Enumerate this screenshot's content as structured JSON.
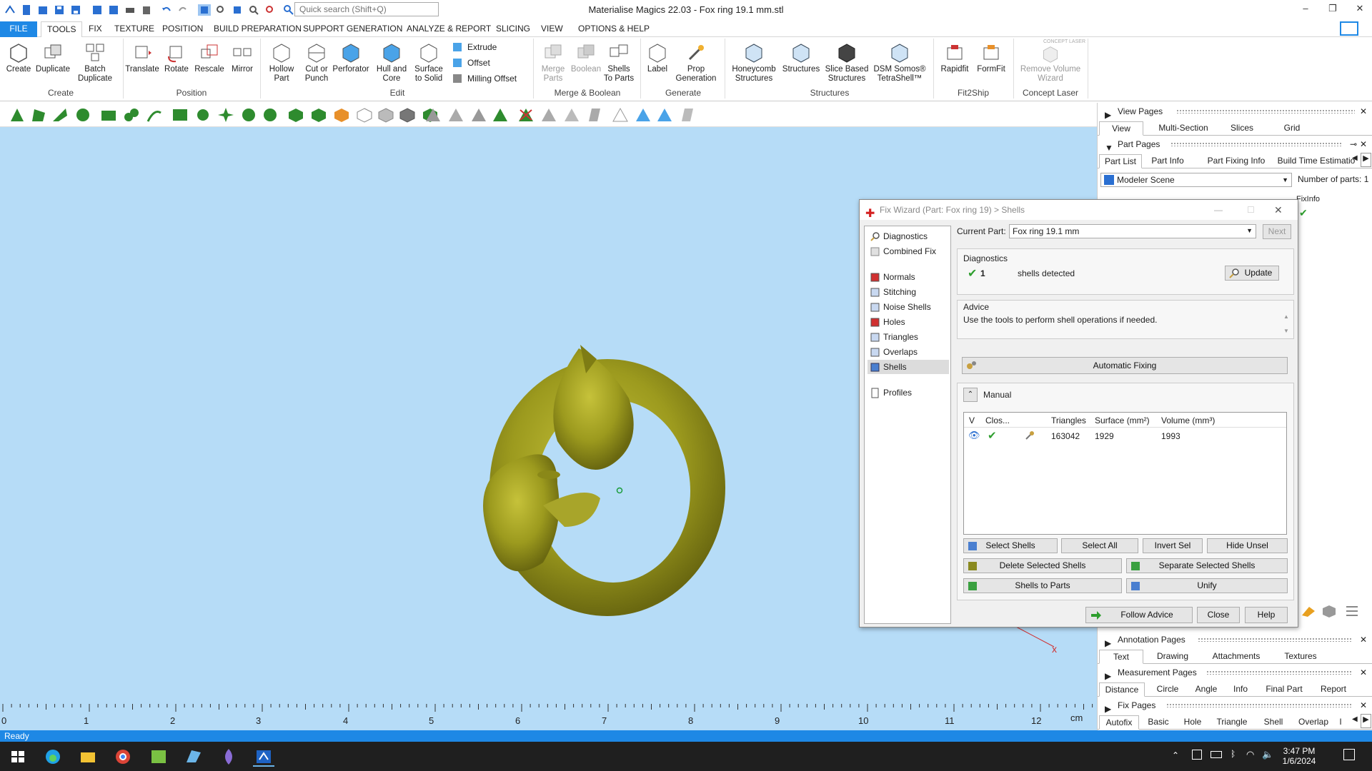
{
  "titlebar": {
    "search_placeholder": "Quick search (Shift+Q)",
    "title": "Materialise Magics 22.03 - Fox ring 19.1 mm.stl"
  },
  "menu": {
    "file": "FILE",
    "tools": "TOOLS",
    "fix": "FIX",
    "texture": "TEXTURE",
    "position": "POSITION",
    "build_preparation": "BUILD PREPARATION",
    "support_generation": "SUPPORT GENERATION",
    "analyze_report": "ANALYZE & REPORT",
    "slicing": "SLICING",
    "view": "VIEW",
    "options_help": "OPTIONS & HELP"
  },
  "ribbon": {
    "create": "Create",
    "duplicate": "Duplicate",
    "batch_duplicate_1": "Batch",
    "batch_duplicate_2": "Duplicate",
    "translate": "Translate",
    "rotate": "Rotate",
    "rescale": "Rescale",
    "mirror": "Mirror",
    "hollow_1": "Hollow",
    "hollow_2": "Part",
    "cut_1": "Cut or",
    "cut_2": "Punch",
    "perforator": "Perforator",
    "hull_1": "Hull and",
    "hull_2": "Core",
    "surface_1": "Surface",
    "surface_2": "to Solid",
    "extrude": "Extrude",
    "offset": "Offset",
    "milling_offset": "Milling Offset",
    "merge_1": "Merge",
    "merge_2": "Parts",
    "boolean": "Boolean",
    "shells_1": "Shells",
    "shells_2": "To Parts",
    "label": "Label",
    "prop_1": "Prop",
    "prop_2": "Generation",
    "honeycomb_1": "Honeycomb",
    "honeycomb_2": "Structures",
    "structures": "Structures",
    "slice_1": "Slice Based",
    "slice_2": "Structures",
    "dsm_1": "DSM Somos®",
    "dsm_2": "TetraShell™",
    "rapidfit": "Rapidfit",
    "formfit": "FormFit",
    "concept_laser_tag": "CONCEPT LASER",
    "remove_1": "Remove Volume",
    "remove_2": "Wizard",
    "groups": {
      "create": "Create",
      "position": "Position",
      "edit": "Edit",
      "merge_boolean": "Merge & Boolean",
      "generate": "Generate",
      "structures": "Structures",
      "fit2ship": "Fit2Ship",
      "concept_laser": "Concept Laser"
    }
  },
  "ruler": {
    "labels": [
      "0",
      "1",
      "2",
      "3",
      "4",
      "5",
      "6",
      "7",
      "8",
      "9",
      "10",
      "11",
      "12"
    ],
    "unit": "cm"
  },
  "status": "Ready",
  "taskbar": {
    "time": "3:47 PM",
    "date": "1/6/2024"
  },
  "right_panel": {
    "view_pages": "View Pages",
    "view_tabs": [
      "View",
      "Multi-Section",
      "Slices",
      "Grid"
    ],
    "part_pages": "Part Pages",
    "part_tabs": [
      "Part List",
      "Part Info",
      "Part Fixing Info",
      "Build Time Estimatio"
    ],
    "scene": "Modeler Scene",
    "number_of_parts_label": "Number of parts:",
    "number_of_parts": "1",
    "fixinfo_header": "FixInfo",
    "annotation_pages": "Annotation Pages",
    "annotation_tabs": [
      "Text",
      "Drawing",
      "Attachments",
      "Textures"
    ],
    "measurement_pages": "Measurement Pages",
    "measurement_tabs": [
      "Distance",
      "Circle",
      "Angle",
      "Info",
      "Final Part",
      "Report"
    ],
    "fix_pages": "Fix Pages",
    "fix_tabs": [
      "Autofix",
      "Basic",
      "Hole",
      "Triangle",
      "Shell",
      "Overlap",
      "I"
    ]
  },
  "fix_wizard": {
    "title": "Fix Wizard (Part: Fox ring 19) > Shells",
    "nav": [
      "Diagnostics",
      "Combined Fix",
      "Normals",
      "Stitching",
      "Noise Shells",
      "Holes",
      "Triangles",
      "Overlaps",
      "Shells",
      "Profiles"
    ],
    "current_part_label": "Current Part:",
    "current_part": "Fox ring 19.1 mm",
    "next": "Next",
    "diagnostics_label": "Diagnostics",
    "shells_count": "1",
    "shells_detected": "shells detected",
    "update": "Update",
    "advice_label": "Advice",
    "advice_text": "Use the tools to perform shell operations if needed.",
    "automatic_fixing": "Automatic Fixing",
    "manual": "Manual",
    "table_headers": [
      "V",
      "Clos...",
      "",
      "Triangles",
      "Surface (mm²)",
      "Volume (mm³)"
    ],
    "row": {
      "triangles": "163042",
      "surface": "1929",
      "volume": "1993"
    },
    "buttons": {
      "select_shells": "Select Shells",
      "select_all": "Select All",
      "invert_sel": "Invert Sel",
      "hide_unsel": "Hide Unsel",
      "delete_selected": "Delete Selected Shells",
      "separate_selected": "Separate Selected Shells",
      "shells_to_parts": "Shells to Parts",
      "unify": "Unify",
      "follow_advice": "Follow Advice",
      "close": "Close",
      "help": "Help"
    }
  }
}
